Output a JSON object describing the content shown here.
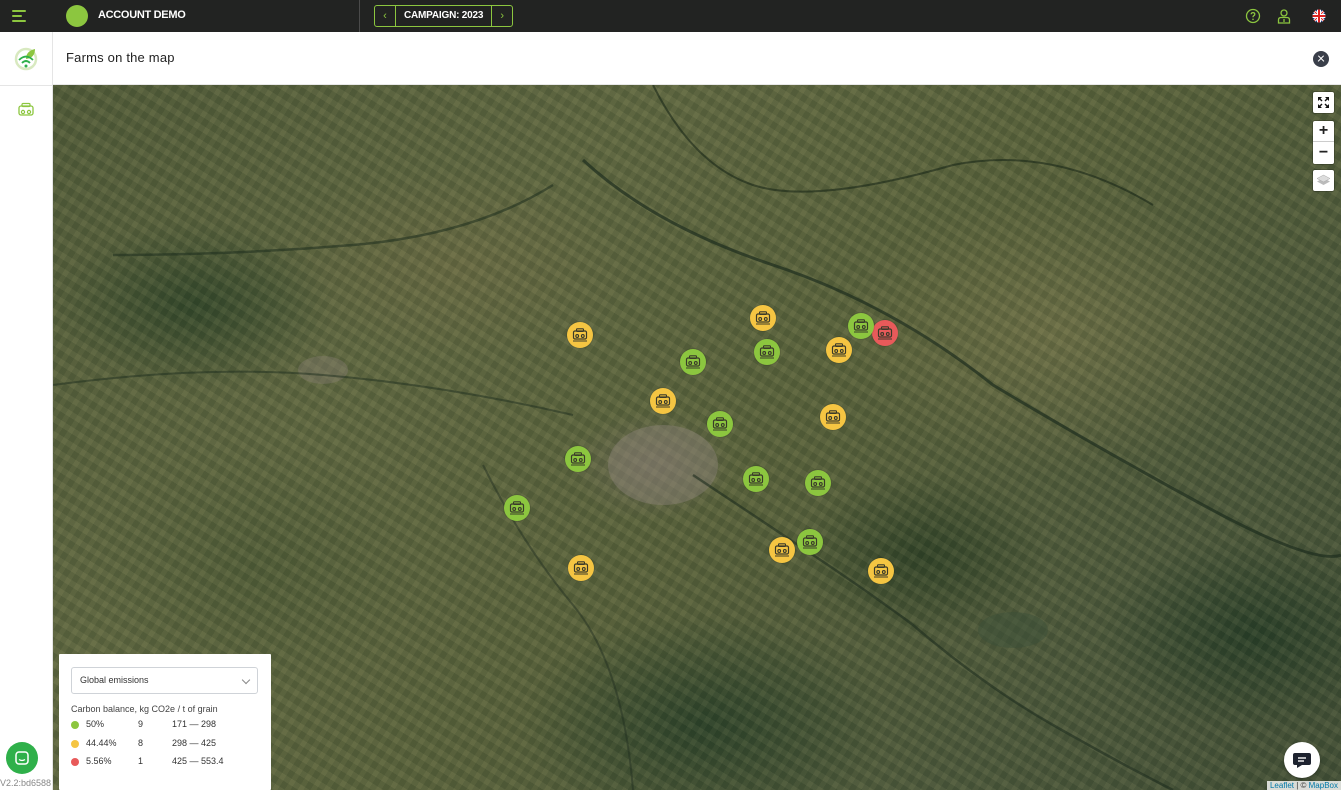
{
  "topbar": {
    "menu_icon": "hamburger-menu-icon",
    "account_name": "ACCOUNT DEMO",
    "account_color": "#8cc63f",
    "campaign_label": "CAMPAIGN: 2023",
    "prev_icon": "chevron-left-icon",
    "next_icon": "chevron-right-icon",
    "right_icons": [
      "help-circle-icon",
      "user-profile-icon",
      "uk-flag-icon"
    ]
  },
  "sidebar": {
    "logo_icon": "leaf-wifi-logo-icon",
    "items": [
      {
        "icon": "tractor-icon"
      }
    ],
    "chat_icon": "chat-icon",
    "version": "V2.2:bd6588"
  },
  "header": {
    "title": "Farms on the map",
    "close_icon": "close-icon"
  },
  "map": {
    "controls": {
      "fullscreen_icon": "fullscreen-icon",
      "zoom_in": "+",
      "zoom_out": "−",
      "layers_icon": "layers-icon"
    },
    "marker_icon": "farm-tractor-icon",
    "colors": {
      "green": "#8cc63f",
      "yellow": "#f5c542",
      "red": "#e85a5a"
    },
    "markers": [
      {
        "category": "yellow"
      },
      {
        "category": "yellow"
      },
      {
        "category": "green"
      },
      {
        "category": "red"
      },
      {
        "category": "green"
      },
      {
        "category": "yellow"
      },
      {
        "category": "green"
      },
      {
        "category": "yellow"
      },
      {
        "category": "green"
      },
      {
        "category": "yellow"
      },
      {
        "category": "green"
      },
      {
        "category": "green"
      },
      {
        "category": "green"
      },
      {
        "category": "green"
      },
      {
        "category": "yellow"
      },
      {
        "category": "green"
      },
      {
        "category": "yellow"
      },
      {
        "category": "yellow"
      }
    ],
    "chat_icon": "chat-bubble-icon",
    "attribution": {
      "leaflet": "Leaflet",
      "sep": " | © ",
      "mapbox": "MapBox"
    }
  },
  "legend": {
    "select_value": "Global emissions",
    "title": "Carbon balance, kg CO2e / t of grain",
    "rows": [
      {
        "color": "#8cc63f",
        "pct": "50%",
        "count": "9",
        "range": "171 — 298"
      },
      {
        "color": "#f5c542",
        "pct": "44.44%",
        "count": "8",
        "range": "298 — 425"
      },
      {
        "color": "#e85a5a",
        "pct": "5.56%",
        "count": "1",
        "range": "425 — 553.4"
      }
    ]
  }
}
